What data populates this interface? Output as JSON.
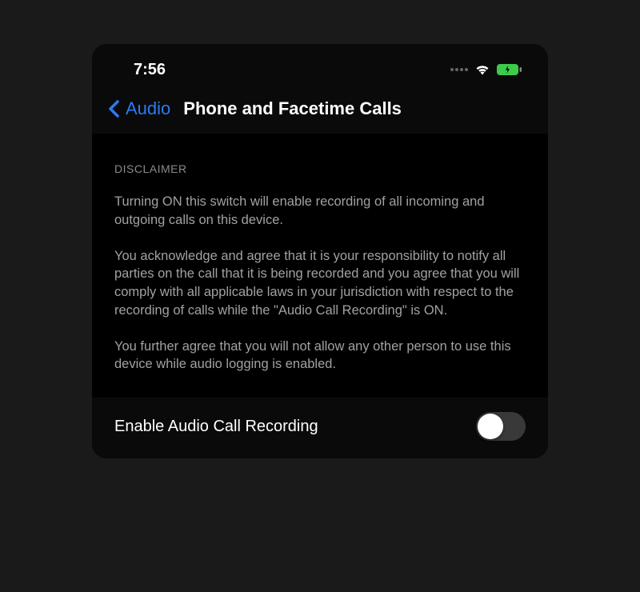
{
  "statusBar": {
    "time": "7:56"
  },
  "nav": {
    "backLabel": "Audio",
    "title": "Phone and Facetime Calls"
  },
  "disclaimer": {
    "heading": "DISCLAIMER",
    "p1": "Turning ON this switch will enable recording of all incoming and outgoing calls on this device.",
    "p2": "You acknowledge and agree that it is your responsibility to notify all parties on the call that it is being recorded and you agree that you will comply with all applicable laws in your jurisdiction with respect to the recording of calls while the \"Audio Call Recording\" is ON.",
    "p3": "You further agree that you will not allow any other person to use this device while audio logging is enabled."
  },
  "toggle": {
    "label": "Enable Audio Call Recording",
    "enabled": false
  },
  "colors": {
    "accent": "#2c7af5",
    "batteryGreen": "#3ccb4a"
  }
}
